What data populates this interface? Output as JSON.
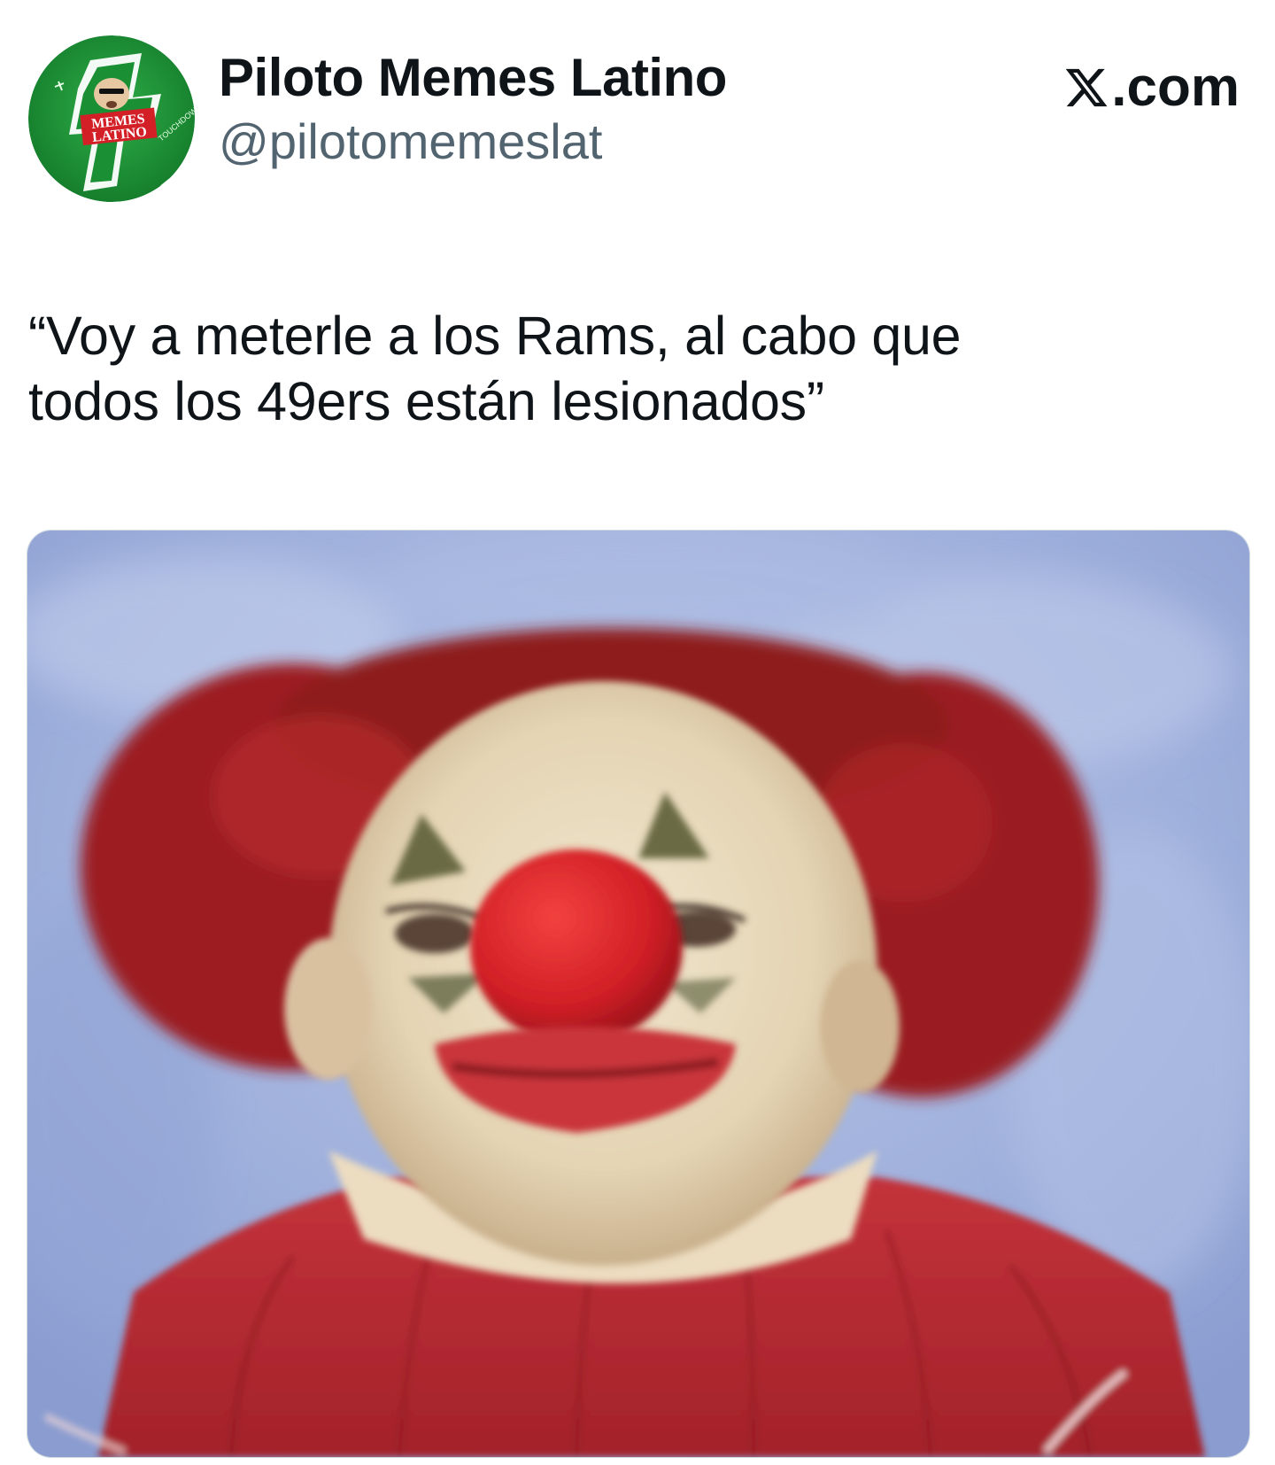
{
  "author": {
    "display_name": "Piloto Memes Latino",
    "handle": "@pilotomemeslat",
    "avatar_text": [
      "MEMES",
      "LATINO"
    ],
    "avatar_small_text": "TOUCHDOWN"
  },
  "brand": {
    "icon": "x-logo-icon",
    "suffix": ".com"
  },
  "tweet": {
    "text_lines": [
      "“Voy a meterle a los Rams, al cabo que",
      "todos los 49ers están lesionados”"
    ]
  },
  "media": {
    "subject": "clown-photo",
    "colors": {
      "background": "#a9b8dd",
      "hair": "#9c1f22",
      "face": "#e8dcc2",
      "nose": "#d8262b",
      "shirt": "#b3272c"
    }
  },
  "colors": {
    "text_primary": "#0f1419",
    "text_secondary": "#536471",
    "avatar_green": "#1f9a37"
  }
}
